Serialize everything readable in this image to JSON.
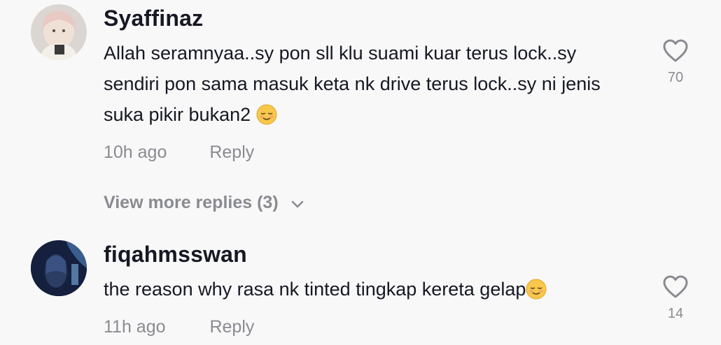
{
  "comments": [
    {
      "username": "Syaffinaz",
      "text": "Allah seramnyaa..sy pon sll klu suami kuar terus lock..sy sendiri pon sama masuk keta nk drive terus lock..sy ni jenis suka pikir bukan2",
      "emoji": "relieved-face-emoji",
      "time": "10h ago",
      "reply_label": "Reply",
      "likes": "70"
    },
    {
      "username": "fiqahmsswan",
      "text": "the reason why rasa nk tinted tingkap kereta gelap",
      "emoji": "relieved-face-emoji",
      "time": "11h ago",
      "reply_label": "Reply",
      "likes": "14"
    }
  ],
  "view_more_replies": "View more replies (3)",
  "colors": {
    "background": "#f8f8f8",
    "primary_text": "#161823",
    "secondary_text": "#8a8b91"
  }
}
